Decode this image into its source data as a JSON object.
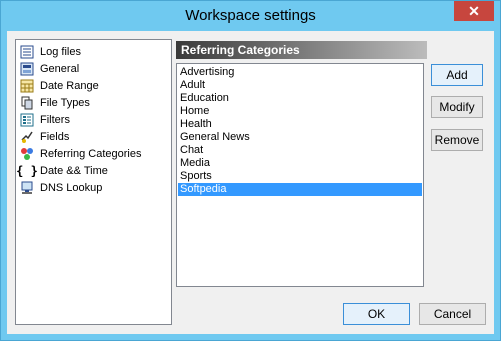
{
  "window": {
    "title": "Workspace settings",
    "close_symbol": "✕"
  },
  "sidebar": {
    "items": [
      {
        "label": "Log files",
        "icon": "log-files-icon"
      },
      {
        "label": "General",
        "icon": "general-icon"
      },
      {
        "label": "Date Range",
        "icon": "calendar-icon"
      },
      {
        "label": "File Types",
        "icon": "file-types-icon"
      },
      {
        "label": "Filters",
        "icon": "filters-icon"
      },
      {
        "label": "Fields",
        "icon": "fields-icon"
      },
      {
        "label": "Referring Categories",
        "icon": "categories-icon"
      },
      {
        "label": "Date && Time",
        "icon": "braces-icon"
      },
      {
        "label": "DNS Lookup",
        "icon": "computer-icon"
      }
    ]
  },
  "panel": {
    "header": "Referring Categories",
    "items": [
      "Advertising",
      "Adult",
      "Education",
      "Home",
      "Health",
      "General News",
      "Chat",
      "Media",
      "Sports",
      "Softpedia"
    ],
    "selected": "Softpedia"
  },
  "buttons": {
    "add": "Add",
    "modify": "Modify",
    "remove": "Remove",
    "ok": "OK",
    "cancel": "Cancel"
  }
}
